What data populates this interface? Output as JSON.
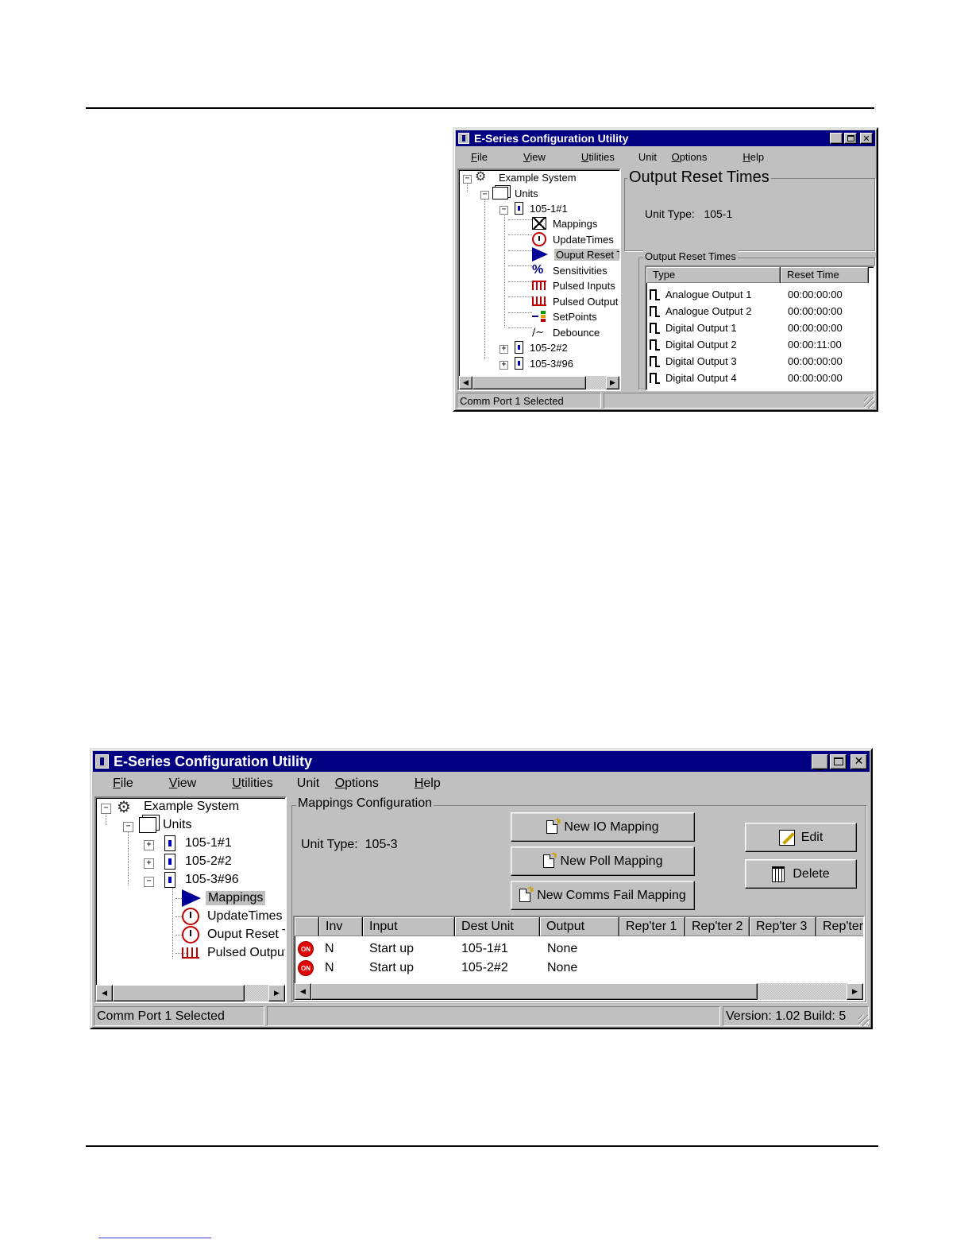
{
  "window1": {
    "title": "E-Series Configuration Utility",
    "menu": [
      {
        "pre": "",
        "key": "F",
        "post": "ile"
      },
      {
        "pre": "",
        "key": "V",
        "post": "iew"
      },
      {
        "pre": "",
        "key": "U",
        "post": "tilities"
      },
      {
        "pre": "Unit ",
        "key": "O",
        "post": "ptions"
      },
      {
        "pre": "",
        "key": "H",
        "post": "elp"
      }
    ],
    "tree": {
      "root": "Example System",
      "units": "Units",
      "unit1": "105-1#1",
      "children": [
        "Mappings",
        "UpdateTimes",
        "Ouput Reset T",
        "Sensitivities",
        "Pulsed Inputs",
        "Pulsed Output",
        "SetPoints",
        "Debounce"
      ],
      "unit2": "105-2#2",
      "unit3": "105-3#96"
    },
    "panel_title": "Output Reset Times",
    "unit_type_label": "Unit Type:",
    "unit_type_value": "105-1",
    "group_title": "Output Reset Times",
    "columns": [
      "Type",
      "Reset Time"
    ],
    "rows": [
      {
        "type": "Analogue Output 1",
        "time": "00:00:00:00"
      },
      {
        "type": "Analogue Output 2",
        "time": "00:00:00:00"
      },
      {
        "type": "Digital Output 1",
        "time": "00:00:00:00"
      },
      {
        "type": "Digital Output 2",
        "time": "00:00:11:00"
      },
      {
        "type": "Digital Output 3",
        "time": "00:00:00:00"
      },
      {
        "type": "Digital Output 4",
        "time": "00:00:00:00"
      }
    ],
    "status": "Comm Port 1 Selected"
  },
  "window2": {
    "title": "E-Series Configuration Utility",
    "menu": [
      {
        "pre": "",
        "key": "F",
        "post": "ile"
      },
      {
        "pre": "",
        "key": "V",
        "post": "iew"
      },
      {
        "pre": "",
        "key": "U",
        "post": "tilities"
      },
      {
        "pre": "Unit ",
        "key": "O",
        "post": "ptions"
      },
      {
        "pre": "",
        "key": "H",
        "post": "elp"
      }
    ],
    "tree": {
      "root": "Example System",
      "units": "Units",
      "unit1": "105-1#1",
      "unit2": "105-2#2",
      "unit3": "105-3#96",
      "children": [
        "Mappings",
        "UpdateTimes",
        "Ouput Reset T",
        "Pulsed Output"
      ]
    },
    "group_title": "Mappings Configuration",
    "unit_type_label": "Unit Type:",
    "unit_type_value": "105-3",
    "buttons": {
      "new_io": "New IO Mapping",
      "new_poll": "New Poll Mapping",
      "new_comms_fail": "New Comms Fail Mapping",
      "edit": "Edit",
      "delete": "Delete"
    },
    "columns": [
      "",
      "Inv",
      "Input",
      "Dest Unit",
      "Output",
      "Rep'ter 1",
      "Rep'ter 2",
      "Rep'ter 3",
      "Rep'ter"
    ],
    "rows": [
      {
        "icon": "ON",
        "inv": "N",
        "input": "Start up",
        "dest": "105-1#1",
        "output": "None"
      },
      {
        "icon": "ON",
        "inv": "N",
        "input": "Start up",
        "dest": "105-2#2",
        "output": "None"
      }
    ],
    "status": "Comm Port 1 Selected",
    "version": "Version: 1.02 Build: 5"
  }
}
